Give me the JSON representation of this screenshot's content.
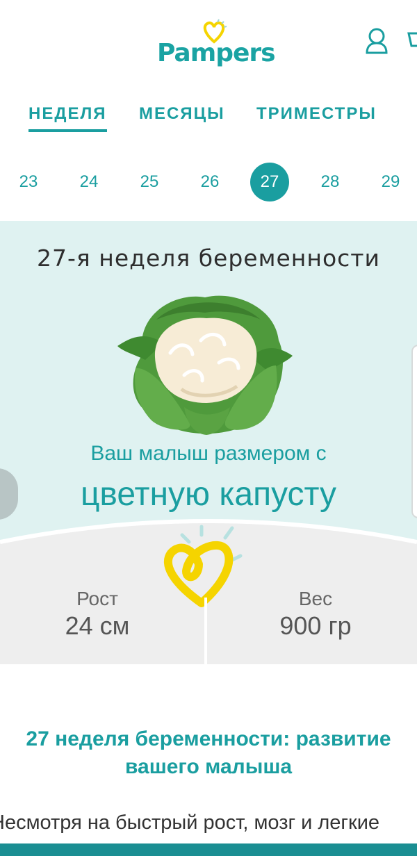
{
  "brand": {
    "logo_text": "Pampers",
    "accent": "#1a9ea0",
    "heart_color": "#f5d400"
  },
  "header": {
    "user_icon": "user-icon",
    "cart_icon": "cart-icon"
  },
  "tabs": [
    {
      "label": "НЕДЕЛЯ",
      "active": true
    },
    {
      "label": "МЕСЯЦЫ",
      "active": false
    },
    {
      "label": "ТРИМЕСТРЫ",
      "active": false
    }
  ],
  "weeks": {
    "items": [
      "23",
      "24",
      "25",
      "26",
      "27",
      "28",
      "29"
    ],
    "selected": "27"
  },
  "hero": {
    "title": "27-я неделя беременности",
    "subtitle": "Ваш малыш размером с",
    "fruit": "цветную капусту",
    "background": "#dff2f1"
  },
  "stats": {
    "height_label": "Рост",
    "height_value": "24 см",
    "weight_label": "Вес",
    "weight_value": "900 гр"
  },
  "article": {
    "title_line1": "27 неделя беременности: развитие",
    "title_line2": "вашего малыша",
    "body_line1": "Несмотря на быстрый рост, мозг и легкие"
  }
}
